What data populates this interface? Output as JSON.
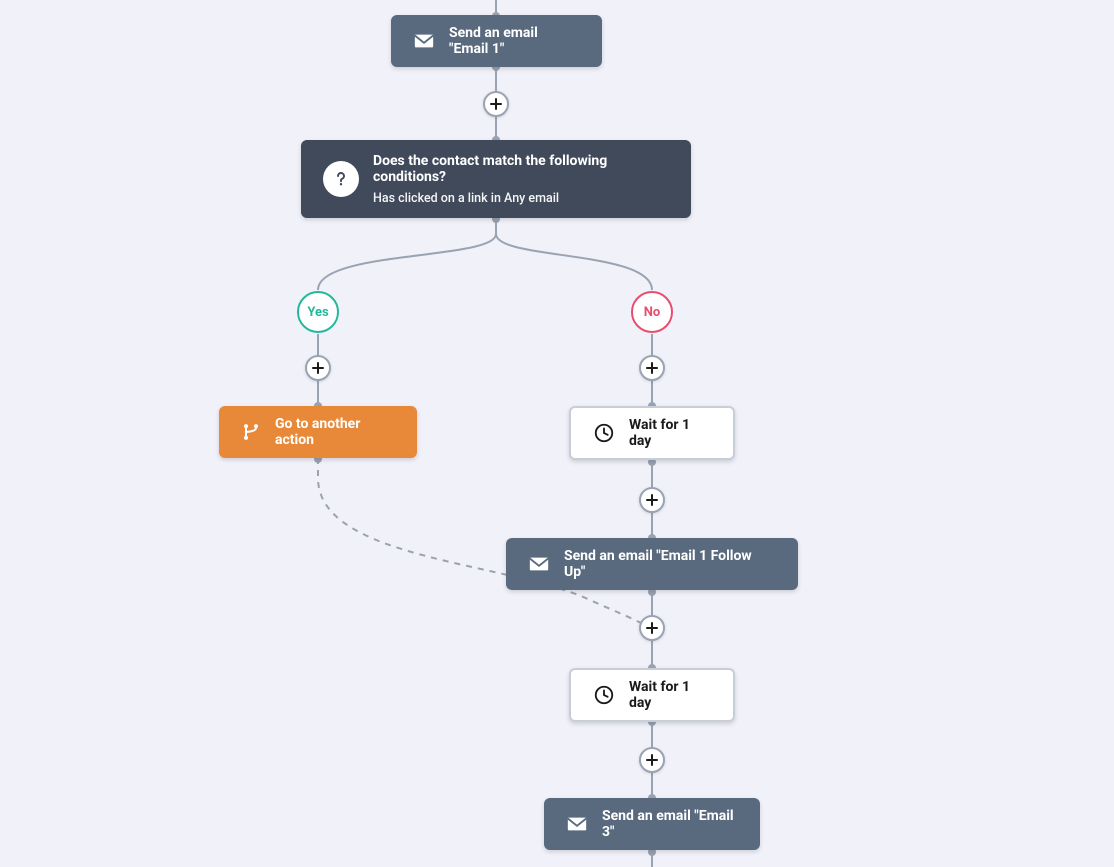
{
  "nodes": {
    "send1": {
      "label": "Send an email \"Email 1\""
    },
    "condition": {
      "title": "Does the contact match the following conditions?",
      "subtitle": "Has clicked on a link in Any email"
    },
    "yes_label": "Yes",
    "no_label": "No",
    "goto": {
      "label": "Go to another action"
    },
    "wait1": {
      "label": "Wait for 1 day"
    },
    "send2": {
      "label": "Send an email \"Email 1 Follow Up\""
    },
    "wait2": {
      "label": "Wait for 1 day"
    },
    "send3": {
      "label": "Send an email \"Email 3\""
    }
  }
}
